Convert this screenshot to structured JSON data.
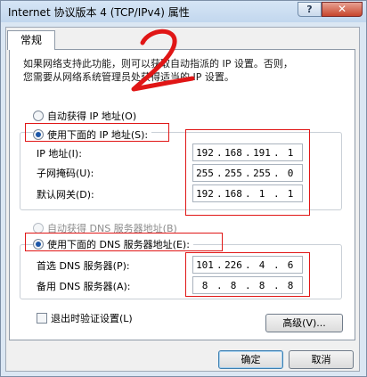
{
  "window": {
    "title": "Internet 协议版本 4 (TCP/IPv4) 属性",
    "help_glyph": "?",
    "close_glyph": "✕"
  },
  "tab": {
    "label": "常规"
  },
  "description": {
    "line1": "如果网络支持此功能，则可以获取自动指派的 IP 设置。否则，",
    "line2": "您需要从网络系统管理员处获得适当的 IP 设置。"
  },
  "ip_section": {
    "auto_label": "自动获得 IP 地址(O)",
    "manual_label": "使用下面的 IP 地址(S):",
    "ip_label": "IP 地址(I):",
    "mask_label": "子网掩码(U):",
    "gateway_label": "默认网关(D):",
    "ip": [
      "192",
      "168",
      "191",
      "1"
    ],
    "mask": [
      "255",
      "255",
      "255",
      "0"
    ],
    "gateway": [
      "192",
      "168",
      "1",
      "1"
    ]
  },
  "dns_section": {
    "auto_label": "自动获得 DNS 服务器地址(B)",
    "manual_label": "使用下面的 DNS 服务器地址(E):",
    "preferred_label": "首选 DNS 服务器(P):",
    "alternate_label": "备用 DNS 服务器(A):",
    "preferred": [
      "101",
      "226",
      "4",
      "6"
    ],
    "alternate": [
      "8",
      "8",
      "8",
      "8"
    ]
  },
  "validate": {
    "label": "退出时验证设置(L)"
  },
  "buttons": {
    "advanced": "高级(V)...",
    "ok": "确定",
    "cancel": "取消"
  },
  "annotation": {
    "number": "2"
  },
  "colors": {
    "highlight": "#e01616",
    "titlebar": "#c2d7ee"
  }
}
